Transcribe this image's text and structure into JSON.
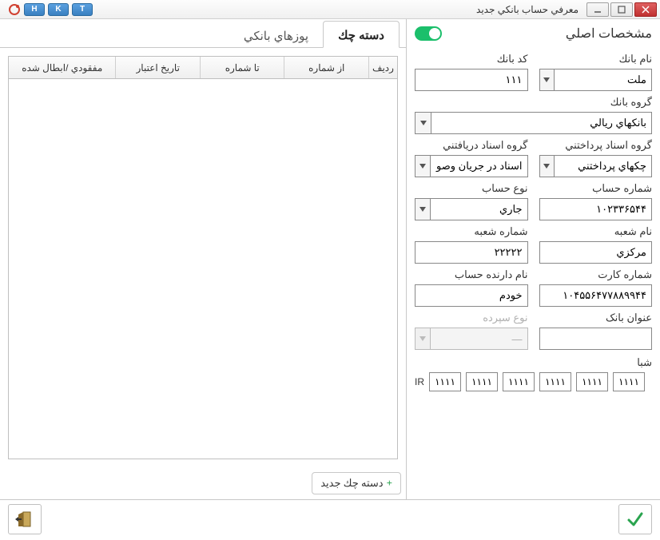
{
  "window": {
    "title": "معرفي حساب بانكي جديد",
    "hotkeys": [
      "H",
      "K",
      "T"
    ]
  },
  "main_section": {
    "title": "مشخصات اصلي",
    "toggle_on": true
  },
  "labels": {
    "bank_name": "نام بانك",
    "bank_code": "كد بانك",
    "bank_group": "گروه بانك",
    "payable_group": "گروه اسناد پرداختني",
    "receivable_group": "گروه اسناد دريافتني",
    "account_number": "شماره حساب",
    "account_type": "نوع حساب",
    "branch_name": "نام شعبه",
    "branch_code": "شماره شعبه",
    "card_number": "شماره كارت",
    "account_holder": "نام دارنده حساب",
    "bank_title": "عنوان بانک",
    "deposit_type": "نوع سپرده",
    "sheba": "شبا"
  },
  "values": {
    "bank_name": "ملت",
    "bank_code": "۱۱۱",
    "bank_group": "بانكهاي ريالي",
    "payable_group": "چكهاي پرداختني",
    "receivable_group": "اسناد در جريان وصول",
    "account_number": "۱۰۲۳۳۶۵۴۴",
    "account_type": "جاري",
    "branch_name": "مركزي",
    "branch_code": "۲۲۲۲۲",
    "card_number": "۱۰۴۵۵۶۴۷۷۸۸۹۹۴۴",
    "account_holder": "خودم",
    "bank_title": "",
    "deposit_type": "—"
  },
  "sheba": {
    "prefix": "IR",
    "parts": [
      "۱۱۱۱",
      "۱۱۱۱",
      "۱۱۱۱",
      "۱۱۱۱",
      "۱۱۱۱",
      "۱۱۱۱"
    ]
  },
  "tabs": {
    "pos": "پوزهاي بانكي",
    "cheque": "دسته چك"
  },
  "table": {
    "cols": {
      "row": "رديف",
      "from": "از شماره",
      "to": "تا شماره",
      "date": "تاريخ اعتبار",
      "void": "مفقودي /ابطال شده"
    }
  },
  "buttons": {
    "add_cheque": "دسته چك جديد"
  }
}
